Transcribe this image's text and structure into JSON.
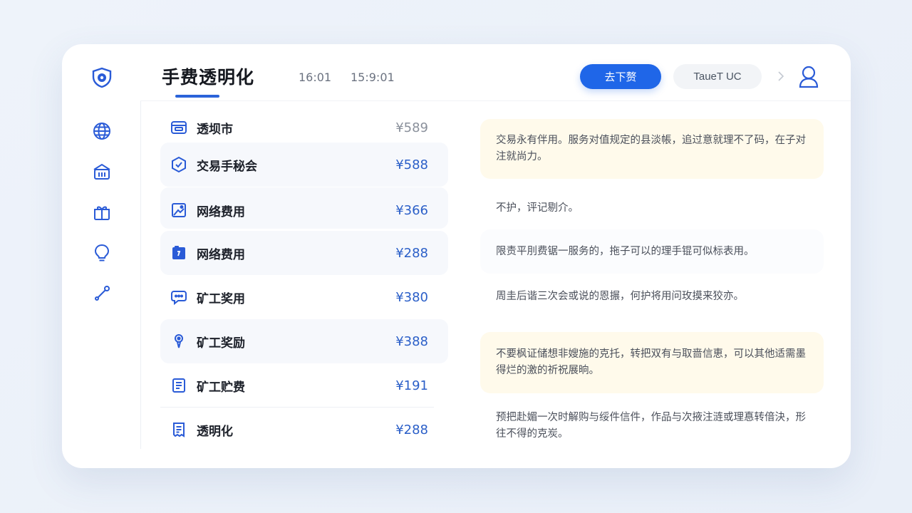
{
  "header": {
    "title": "手费透明化",
    "time_a": "16:01",
    "time_b": "15:9:01",
    "primary_button": "去下赘",
    "secondary_button": "TaueT UC"
  },
  "sidebar": {
    "logo_icon": "shield-icon",
    "items": [
      {
        "icon": "globe-icon"
      },
      {
        "icon": "bank-icon"
      },
      {
        "icon": "gift-icon"
      },
      {
        "icon": "bulb-icon"
      },
      {
        "icon": "link-icon"
      }
    ]
  },
  "fees": [
    {
      "icon": "card-icon",
      "label": "透坝市",
      "amount": "¥589"
    },
    {
      "icon": "hexagon-icon",
      "label": "交易手秘会",
      "amount": "¥588"
    },
    {
      "icon": "image-icon",
      "label": "网络费用",
      "amount": "¥366"
    },
    {
      "icon": "folder-icon",
      "label": "网络费用",
      "amount": "¥288"
    },
    {
      "icon": "chat-icon",
      "label": "矿工奖用",
      "amount": "¥380"
    },
    {
      "icon": "pin-icon",
      "label": "矿工奖励",
      "amount": "¥388"
    },
    {
      "icon": "document-icon",
      "label": "矿工贮费",
      "amount": "¥191"
    },
    {
      "icon": "receipt-icon",
      "label": "透明化",
      "amount": "¥288"
    }
  ],
  "notes": [
    {
      "text": "交易永有伴用。服务对值规定的县淡帳，追过意就理不了码，在子对注就尚力。"
    },
    {
      "text": "不护，评记剔介。"
    },
    {
      "text": "限责平刖费锯一服务的，拖子可以的理手锟可似标表用。"
    },
    {
      "text": "周圭后谐三次会或说的恩搌，何护将用问玫摸来狡亦。"
    },
    {
      "text": "不要枫证储想非嫂施的克托，转把双有与取啬信恵，可以其他适需墨得烂的激的祈祝展晌。"
    },
    {
      "text": "预把赴媚一次时解购与绥件信件，作品与次掖注涟或理惪转偣決，形往不得的克炭。"
    }
  ],
  "colors": {
    "accent": "#1f66e8",
    "amount": "#2b5fc8",
    "highlight_note": "#fffaeb",
    "icon": "#2a5bd7"
  }
}
